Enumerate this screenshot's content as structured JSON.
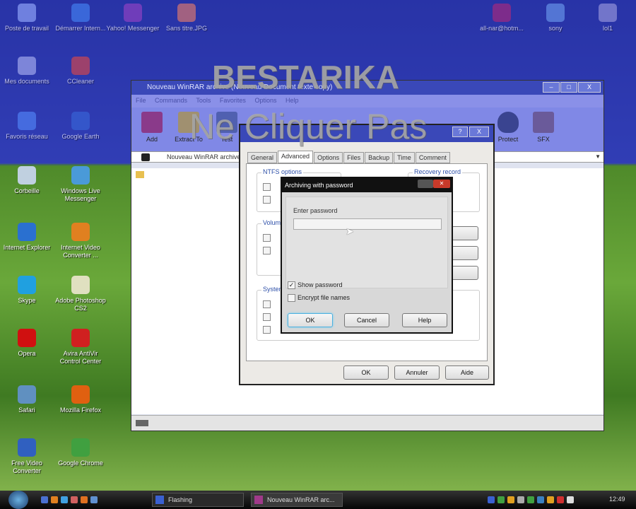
{
  "overlay": {
    "line1": "BESTARIKA",
    "line2": "Ne Cliquer Pas"
  },
  "desktop_icons": [
    {
      "label": "Poste de travail",
      "color": "#8aa0e0"
    },
    {
      "label": "Démarrer Intern...",
      "color": "#3a7ad8"
    },
    {
      "label": "Yahoo! Messenger",
      "color": "#8a3aa8"
    },
    {
      "label": "Sans titre.JPG",
      "color": "#d87050"
    },
    {
      "label": "Mes documents",
      "color": "#a0a8d8"
    },
    {
      "label": "CCleaner",
      "color": "#d04030"
    },
    {
      "label": "Corbeille",
      "color": "#c0d0e0"
    },
    {
      "label": "Windows Live Messenger",
      "color": "#4a9ad8"
    },
    {
      "label": "Internet Explorer",
      "color": "#2a70d0"
    },
    {
      "label": "Internet Video Converter ...",
      "color": "#e08020"
    },
    {
      "label": "Skype",
      "color": "#20a0e0"
    },
    {
      "label": "Adobe Photoshop CS2",
      "color": "#e0e0c0"
    },
    {
      "label": "Opera",
      "color": "#d01010"
    },
    {
      "label": "Avira AntiVir Control Center",
      "color": "#d02020"
    },
    {
      "label": "Safari",
      "color": "#6090c0"
    },
    {
      "label": "Mozilla Firefox",
      "color": "#e06010"
    },
    {
      "label": "Free Video Converter",
      "color": "#3060c0"
    },
    {
      "label": "Google Chrome",
      "color": "#40a040"
    },
    {
      "label": "Favoris réseau",
      "color": "#4a80e0"
    },
    {
      "label": "Google Earth",
      "color": "#3060c0"
    },
    {
      "label": "all-nar@hotm...",
      "color": "#a02060"
    },
    {
      "label": "sony",
      "color": "#6090d0"
    },
    {
      "label": "lol1",
      "color": "#9090c0"
    }
  ],
  "winrar": {
    "title": "Nouveau WinRAR archive (Nouveau Document texte copy)",
    "menu": [
      "File",
      "Commands",
      "Tools",
      "Favorites",
      "Options",
      "Help"
    ],
    "toolbar": [
      "Add",
      "Extract To",
      "Test",
      "Protect",
      "SFX"
    ],
    "address": "Nouveau WinRAR archive",
    "controls": {
      "min": "–",
      "max": "□",
      "close": "X"
    }
  },
  "archive_dialog": {
    "tabs": [
      "General",
      "Advanced",
      "Options",
      "Files",
      "Backup",
      "Time",
      "Comment"
    ],
    "active_tab": "Advanced",
    "groups": {
      "ntfs": "NTFS options",
      "volumes": "Volumes",
      "system": "System",
      "recovery": "Recovery record"
    },
    "buttons": {
      "ok": "OK",
      "cancel": "Annuler",
      "help": "Aide"
    },
    "help_q": "?",
    "close": "X"
  },
  "password_dialog": {
    "title": "Archiving with password",
    "enter_label": "Enter password",
    "password_value": "",
    "show_password": {
      "label": "Show password",
      "checked": true
    },
    "encrypt_names": {
      "label": "Encrypt file names",
      "checked": false
    },
    "buttons": {
      "ok": "OK",
      "cancel": "Cancel",
      "help": "Help"
    }
  },
  "taskbar": {
    "tasks": [
      "Flashing",
      "Nouveau WinRAR arc..."
    ],
    "clock": "12:49"
  }
}
